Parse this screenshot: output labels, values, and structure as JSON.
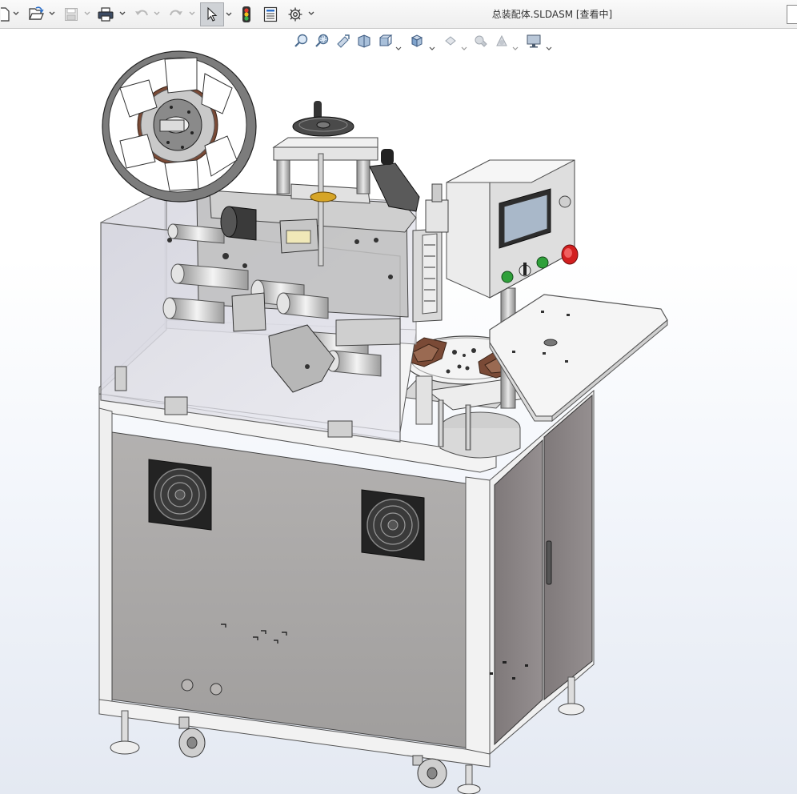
{
  "window": {
    "title": "总装配体.SLDASM [查看中]"
  },
  "toolbar": {
    "buttons": [
      {
        "name": "new-document",
        "icon": "new-document-icon"
      },
      {
        "name": "open",
        "icon": "open-folder-icon"
      },
      {
        "name": "save",
        "icon": "save-icon",
        "state": "disabled"
      },
      {
        "name": "print",
        "icon": "printer-icon"
      },
      {
        "name": "undo",
        "icon": "undo-icon",
        "state": "disabled"
      },
      {
        "name": "redo",
        "icon": "redo-icon",
        "state": "disabled"
      },
      {
        "name": "select",
        "icon": "cursor-icon",
        "state": "active"
      },
      {
        "name": "rebuild",
        "icon": "traffic-light-icon"
      },
      {
        "name": "file-properties",
        "icon": "properties-icon"
      },
      {
        "name": "options",
        "icon": "gear-icon"
      }
    ]
  },
  "heads_up_toolbar": {
    "buttons": [
      {
        "name": "zoom-to-fit",
        "icon": "zoom-fit-icon"
      },
      {
        "name": "zoom-to-area",
        "icon": "zoom-area-icon"
      },
      {
        "name": "previous-view",
        "icon": "previous-view-icon"
      },
      {
        "name": "section-view",
        "icon": "section-view-icon"
      },
      {
        "name": "dynamic-annotation",
        "icon": "annotation-view-icon"
      },
      {
        "name": "view-orientation",
        "icon": "view-cube-icon"
      },
      {
        "name": "display-style",
        "icon": "display-style-icon"
      },
      {
        "name": "hide-show-items",
        "icon": "eye-icon"
      },
      {
        "name": "edit-appearance",
        "icon": "appearance-sphere-icon"
      },
      {
        "name": "apply-scene",
        "icon": "scene-icon"
      },
      {
        "name": "view-settings",
        "icon": "monitor-icon"
      }
    ]
  },
  "colors": {
    "viewport_bg_bottom": "#e4e9f2",
    "cabinet_gray": "#a9a7a6",
    "cabinet_door": "#8b8586",
    "frame_white": "#f2f2f2",
    "glass": "#d9d9e2",
    "tape_brown": "#7a4a36",
    "estop_red": "#d21f1f",
    "button_green": "#2fa03a",
    "hmi_screen": "#a9b8c9",
    "brass": "#d6a527"
  }
}
